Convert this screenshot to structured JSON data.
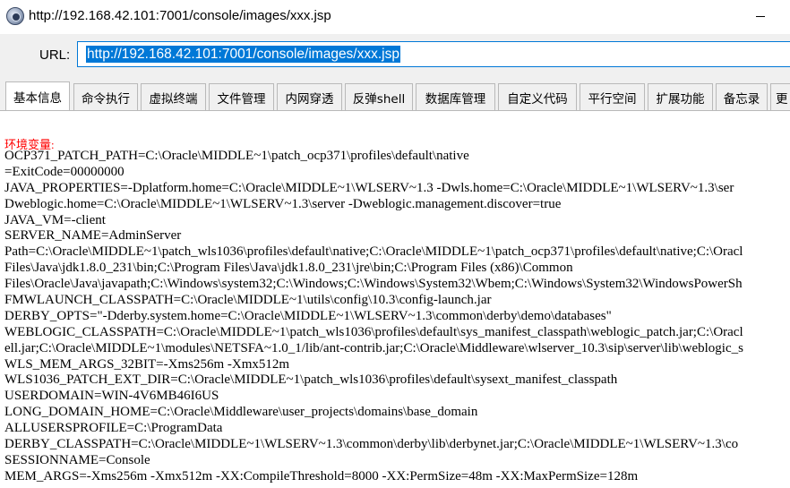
{
  "window": {
    "title": "http://192.168.42.101:7001/console/images/xxx.jsp",
    "app_icon": "app-logo-icon",
    "minimize_glyph": "minimize-icon",
    "maximize_glyph": "□"
  },
  "urlbar": {
    "label": "URL:",
    "value": "http://192.168.42.101:7001/console/images/xxx.jsp",
    "selection_color": "#0078d7"
  },
  "tabs": [
    {
      "label": "基本信息",
      "active": true
    },
    {
      "label": "命令执行",
      "active": false
    },
    {
      "label": "虚拟终端",
      "active": false
    },
    {
      "label": "文件管理",
      "active": false
    },
    {
      "label": "内网穿透",
      "active": false
    },
    {
      "label": "反弹shell",
      "active": false
    },
    {
      "label": "数据库管理",
      "active": false
    },
    {
      "label": "自定义代码",
      "active": false
    },
    {
      "label": "平行空间",
      "active": false
    },
    {
      "label": "扩展功能",
      "active": false
    },
    {
      "label": "备忘录",
      "active": false
    },
    {
      "label": "更",
      "active": false
    }
  ],
  "content": {
    "env_label": "环境变量:",
    "env_label_color": "#ff0000",
    "lines": [
      "OCP371_PATCH_PATH=C:\\Oracle\\MIDDLE~1\\patch_ocp371\\profiles\\default\\native",
      "=ExitCode=00000000",
      "JAVA_PROPERTIES=-Dplatform.home=C:\\Oracle\\MIDDLE~1\\WLSERV~1.3 -Dwls.home=C:\\Oracle\\MIDDLE~1\\WLSERV~1.3\\ser",
      "Dweblogic.home=C:\\Oracle\\MIDDLE~1\\WLSERV~1.3\\server -Dweblogic.management.discover=true",
      "JAVA_VM=-client",
      "SERVER_NAME=AdminServer",
      "Path=C:\\Oracle\\MIDDLE~1\\patch_wls1036\\profiles\\default\\native;C:\\Oracle\\MIDDLE~1\\patch_ocp371\\profiles\\default\\native;C:\\Oracl",
      "Files\\Java\\jdk1.8.0_231\\bin;C:\\Program Files\\Java\\jdk1.8.0_231\\jre\\bin;C:\\Program Files (x86)\\Common",
      "Files\\Oracle\\Java\\javapath;C:\\Windows\\system32;C:\\Windows;C:\\Windows\\System32\\Wbem;C:\\Windows\\System32\\WindowsPowerSh",
      "FMWLAUNCH_CLASSPATH=C:\\Oracle\\MIDDLE~1\\utils\\config\\10.3\\config-launch.jar",
      "DERBY_OPTS=\"-Dderby.system.home=C:\\Oracle\\MIDDLE~1\\WLSERV~1.3\\common\\derby\\demo\\databases\"",
      "WEBLOGIC_CLASSPATH=C:\\Oracle\\MIDDLE~1\\patch_wls1036\\profiles\\default\\sys_manifest_classpath\\weblogic_patch.jar;C:\\Oracl",
      "ell.jar;C:\\Oracle\\MIDDLE~1\\modules\\NETSFA~1.0_1/lib/ant-contrib.jar;C:\\Oracle\\Middleware\\wlserver_10.3\\sip\\server\\lib\\weblogic_s",
      "WLS_MEM_ARGS_32BIT=-Xms256m -Xmx512m",
      "WLS1036_PATCH_EXT_DIR=C:\\Oracle\\MIDDLE~1\\patch_wls1036\\profiles\\default\\sysext_manifest_classpath",
      "USERDOMAIN=WIN-4V6MB46I6US",
      "LONG_DOMAIN_HOME=C:\\Oracle\\Middleware\\user_projects\\domains\\base_domain",
      "ALLUSERSPROFILE=C:\\ProgramData",
      "DERBY_CLASSPATH=C:\\Oracle\\MIDDLE~1\\WLSERV~1.3\\common\\derby\\lib\\derbynet.jar;C:\\Oracle\\MIDDLE~1\\WLSERV~1.3\\co",
      "SESSIONNAME=Console",
      "MEM_ARGS=-Xms256m -Xmx512m -XX:CompileThreshold=8000 -XX:PermSize=48m -XX:MaxPermSize=128m"
    ]
  }
}
